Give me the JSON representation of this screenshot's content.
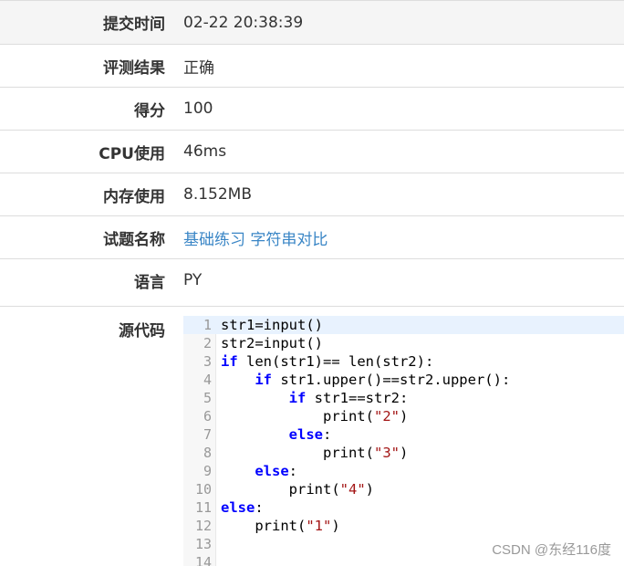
{
  "details": [
    {
      "label": "提交时间",
      "value": "02-22 20:38:39",
      "link": false
    },
    {
      "label": "评测结果",
      "value": "正确",
      "link": false
    },
    {
      "label": "得分",
      "value": "100",
      "link": false
    },
    {
      "label": "CPU使用",
      "value": "46ms",
      "link": false
    },
    {
      "label": "内存使用",
      "value": "8.152MB",
      "link": false
    },
    {
      "label": "试题名称",
      "value": "基础练习 字符串对比",
      "link": true
    },
    {
      "label": "语言",
      "value": "PY",
      "link": false
    }
  ],
  "source": {
    "label": "源代码",
    "lines": [
      {
        "n": "1",
        "code": "str1=input()"
      },
      {
        "n": "2",
        "code": "str2=input()"
      },
      {
        "n": "3",
        "code": "if len(str1)== len(str2):"
      },
      {
        "n": "4",
        "code": "    if str1.upper()==str2.upper():"
      },
      {
        "n": "5",
        "code": "        if str1==str2:"
      },
      {
        "n": "6",
        "code": "            print(\"2\")"
      },
      {
        "n": "7",
        "code": "        else:"
      },
      {
        "n": "8",
        "code": "            print(\"3\")"
      },
      {
        "n": "9",
        "code": "    else:"
      },
      {
        "n": "10",
        "code": "        print(\"4\")"
      },
      {
        "n": "11",
        "code": "else:"
      },
      {
        "n": "12",
        "code": "    print(\"1\")"
      },
      {
        "n": "13",
        "code": ""
      },
      {
        "n": "14",
        "code": ""
      }
    ]
  },
  "watermark": "CSDN @东经116度"
}
